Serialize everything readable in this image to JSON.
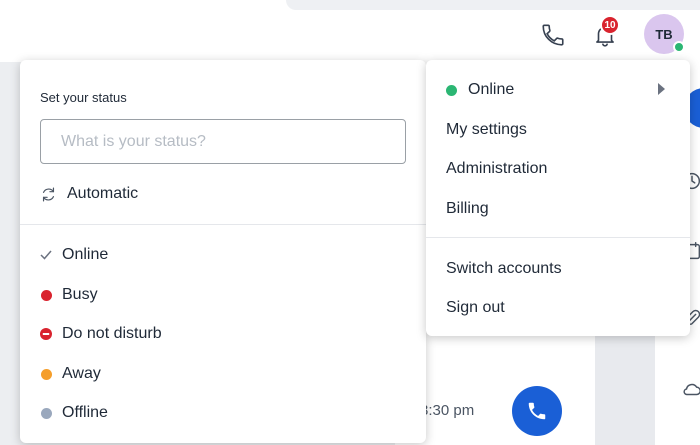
{
  "header": {
    "notification_count": "10",
    "avatar_initials": "TB",
    "presence_color": "#2bb673"
  },
  "background": {
    "time_text": "3:30 pm"
  },
  "status_menu": {
    "heading": "Set your status",
    "input_placeholder": "What is your status?",
    "input_value": "",
    "automatic_label": "Automatic",
    "items": [
      {
        "label": "Online",
        "selected": true,
        "color": "#6b7280"
      },
      {
        "label": "Busy",
        "color": "#d9232e"
      },
      {
        "label": "Do not disturb",
        "color": "#d9232e"
      },
      {
        "label": "Away",
        "color": "#f59e2a"
      },
      {
        "label": "Offline",
        "color": "#9aa8bd"
      }
    ]
  },
  "account_menu": {
    "current_status": "Online",
    "items": [
      "My settings",
      "Administration",
      "Billing",
      "Switch accounts",
      "Sign out"
    ]
  }
}
